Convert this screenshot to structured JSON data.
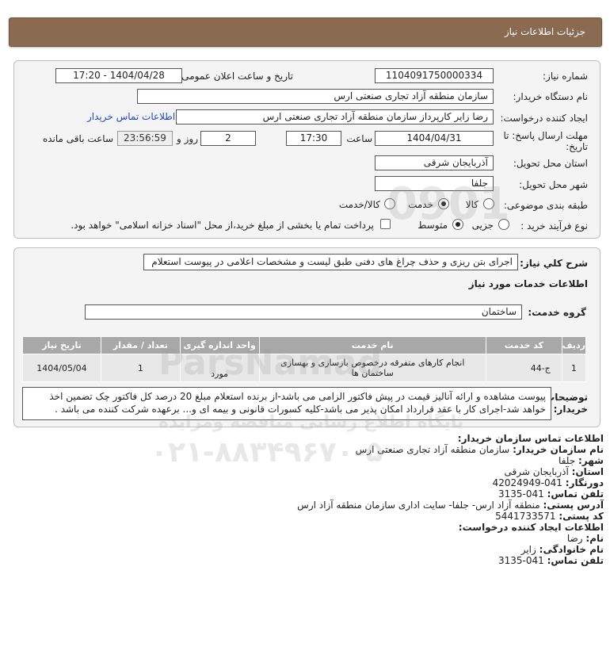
{
  "header": {
    "title": "جزئیات اطلاعات نیاز"
  },
  "form": {
    "need_number_label": "شماره نیاز:",
    "need_number": "1104091750000334",
    "announce_label": "تاریخ و ساعت اعلان عمومی:",
    "announce_value": "1404/04/28 - 17:20",
    "buyer_org_label": "نام دستگاه خریدار:",
    "buyer_org": "سازمان منطقه آزاد تجاری صنعتی ارس",
    "creator_label": "ایجاد کننده درخواست:",
    "creator": "رضا زایر کارپرداز سازمان منطقه آزاد تجاری صنعتی ارس",
    "contact_link": "اطلاعات تماس خریدار",
    "deadline_label_1": "مهلت ارسال پاسخ: تا",
    "deadline_label_2": "تاریخ:",
    "deadline_date": "1404/04/31",
    "time_label": "ساعت",
    "deadline_time": "17:30",
    "days_value": "2",
    "days_label": "روز و",
    "remaining_value": "23:56:59",
    "remaining_label": "ساعت باقی مانده",
    "province_label": "استان محل تحویل:",
    "province": "آذربایجان شرقی",
    "city_label": "شهر محل تحویل:",
    "city": "جلفا",
    "category_label": "طبقه بندی موضوعی:",
    "category_options": [
      "کالا",
      "خدمت",
      "کالا/خدمت"
    ],
    "process_label": "نوع فرآیند خرید :",
    "process_options": [
      "جزیی",
      "متوسط"
    ],
    "payment_note": "پرداخت تمام یا بخشی از مبلغ خرید،از محل \"اسناد خزانه اسلامی\" خواهد بود."
  },
  "description": {
    "label": "شرح كلي نیاز:",
    "text": "اجرای بتن ریزی و حذف چراغ های دفنی طبق لیست و مشخصات اعلامی در پیوست استعلام",
    "services_title": "اطلاعات خدمات مورد نیاز",
    "service_group_label": "گروه خدمت:",
    "service_group": "ساختمان"
  },
  "table": {
    "headers": [
      "ردیف",
      "کد خدمت",
      "نام خدمت",
      "واحد اندازه گیری",
      "تعداد / مقدار",
      "تاریخ نیاز"
    ],
    "rows": [
      [
        "1",
        "ج-44",
        "انجام کارهای متفرقه درخصوص بازسازی و بهسازی ساختمان ها",
        "مورد",
        "1",
        "1404/05/04"
      ]
    ]
  },
  "notes": {
    "label_1": "توضیحات",
    "label_2": "خریدار:",
    "text": "پیوست مشاهده و ارائه آنالیز قیمت در پیش فاکتور الزامی می باشد-از برنده استعلام مبلغ 20 درصد کل فاکتور چک تضمین اخذ خواهد شد-اجرای کار با عقد قرارداد امکان پذیر می باشد-کلیه کسورات قانونی و بیمه ای و... برعهده شرکت کننده می باشد ."
  },
  "contact": {
    "title": "اطلاعات تماس سازمان خریدار:",
    "org_label": "نام سازمان خریدار:",
    "org": "سازمان منطقه آزاد تجاری صنعتی ارس",
    "city_label": "شهر:",
    "city": "جلفا",
    "province_label": "استان:",
    "province": "آذربایجان شرقی",
    "fax_label": "دورنگار:",
    "fax": "041-42024949",
    "phone_label": "تلفن تماس:",
    "phone": "041-3135",
    "address_label": "آدرس پستی:",
    "address": "منطقه آزاد ارس- جلفا- سایت اداری سازمان منطقه آزاد ارس",
    "postal_label": "کد پستی:",
    "postal": "5441733571",
    "creator_title": "اطلاعات ایجاد کننده درخواست:",
    "first_name_label": "نام:",
    "first_name": "رضا",
    "last_name_label": "نام خانوادگی:",
    "last_name": "زایر",
    "creator_phone_label": "تلفن تماس:",
    "creator_phone": "041-3135"
  },
  "watermark": {
    "brand": "ParsNamad",
    "caption": "پایگاه اطلاع رسانی مناقصه ومزایده",
    "phone": "۰۲۱-۸۸۳۴۹۶۷۰-۵",
    "digits": "0901"
  }
}
